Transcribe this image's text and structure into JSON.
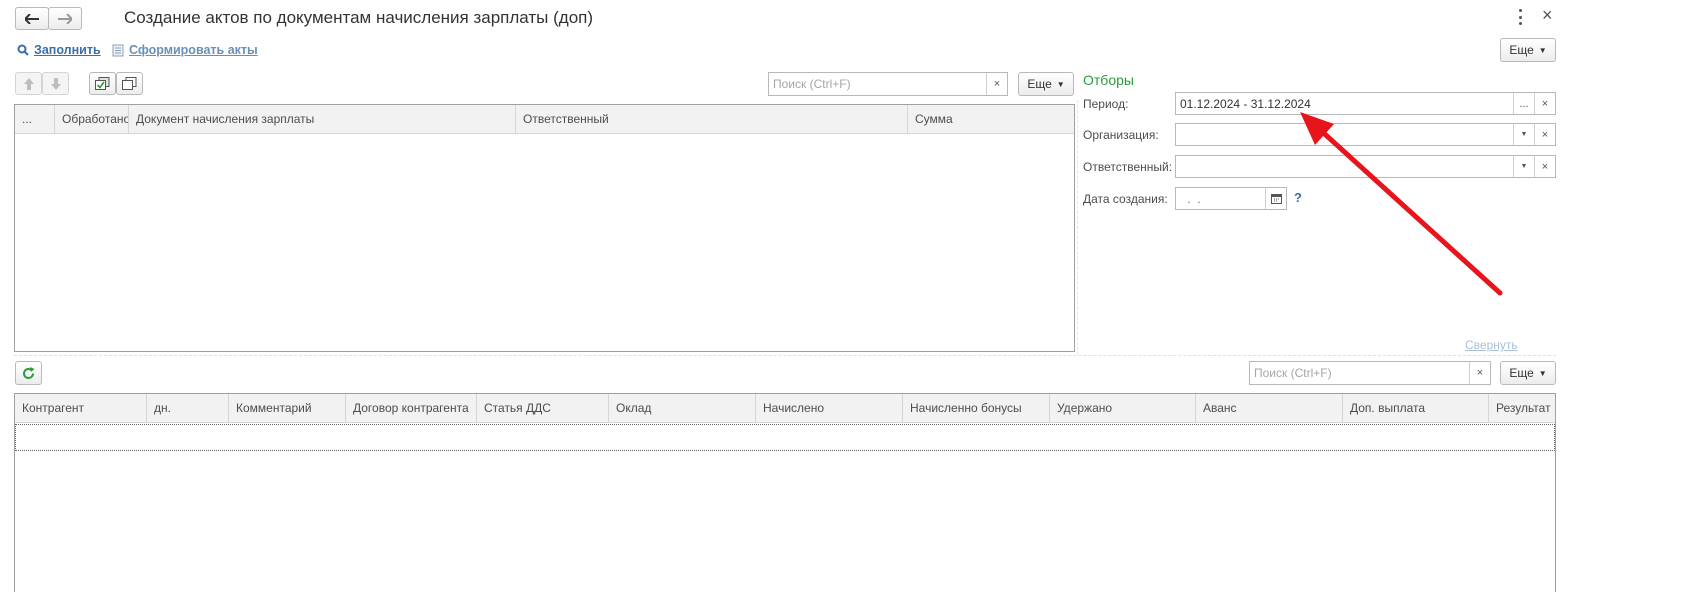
{
  "window": {
    "title": "Создание актов по документам начисления зарплаты (доп)"
  },
  "toolbar": {
    "fill_label": "Заполнить",
    "form_acts_label": "Сформировать акты",
    "more_label": "Еще"
  },
  "top_list": {
    "search_placeholder": "Поиск (Ctrl+F)",
    "more_label": "Еще",
    "columns": [
      "...",
      "Обработано",
      "Документ начисления зарплаты",
      "Ответственный",
      "Сумма"
    ]
  },
  "filters": {
    "title": "Отборы",
    "period_label": "Период:",
    "period_value": "01.12.2024 - 31.12.2024",
    "organization_label": "Организация:",
    "organization_value": "",
    "responsible_label": "Ответственный:",
    "responsible_value": "",
    "created_date_label": "Дата создания:",
    "created_date_value": " .  .",
    "help_label": "?",
    "collapse_label": "Свернуть"
  },
  "bottom_list": {
    "search_placeholder": "Поиск (Ctrl+F)",
    "more_label": "Еще",
    "columns": [
      "Контрагент",
      "дн.",
      "Комментарий",
      "Договор контрагента",
      "Статья ДДС",
      "Оклад",
      "Начислено",
      "Начисленно бонусы",
      "Удержано",
      "Аванс",
      "Доп. выплата",
      "Результат"
    ]
  },
  "colors": {
    "accent_green": "#2b9c3a",
    "link_blue": "#3a6fa8",
    "annotation_red": "#e8141c"
  }
}
